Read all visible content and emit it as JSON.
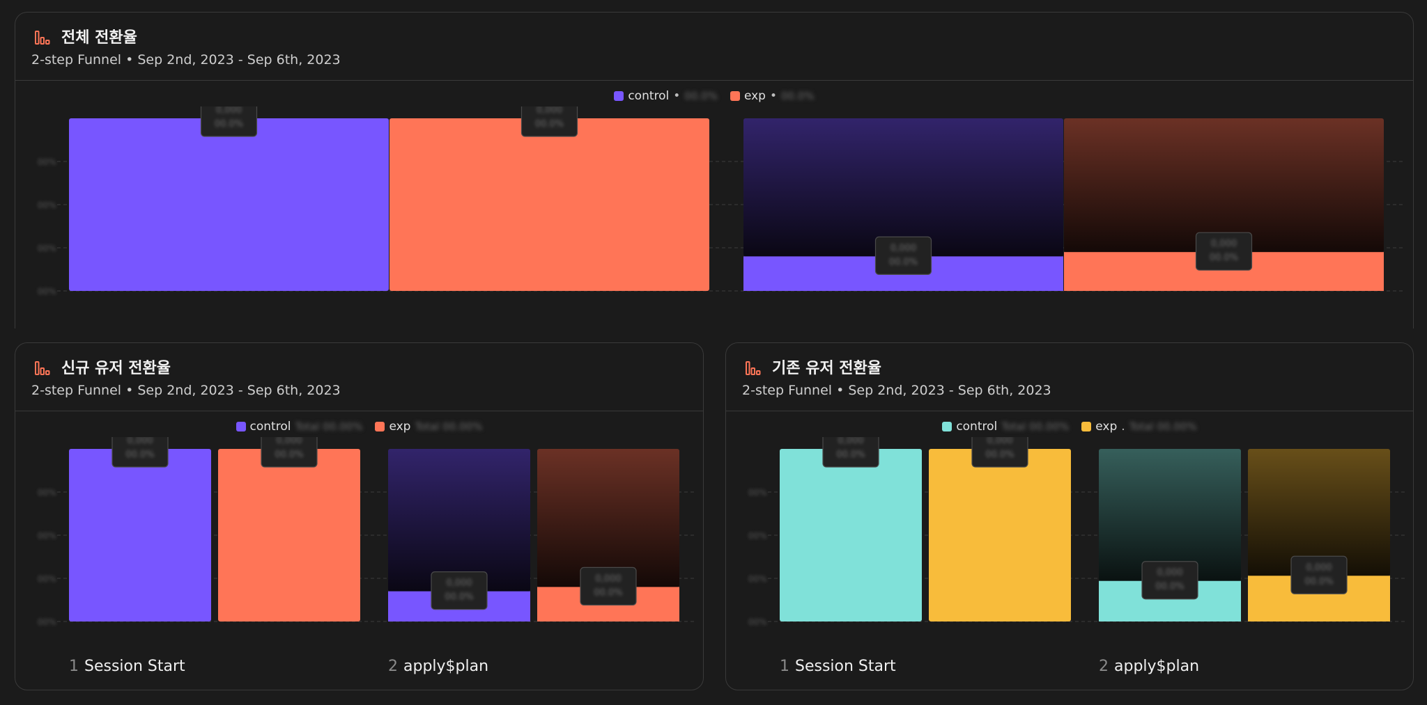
{
  "cards": [
    {
      "title": "전체 전환율",
      "subtitle": "2-step Funnel • Sep 2nd, 2023 - Sep 6th, 2023",
      "legend": [
        {
          "name": "control",
          "sep": "•",
          "color": "#7856ff"
        },
        {
          "name": "exp",
          "sep": "•",
          "color": "#ff7557"
        }
      ]
    },
    {
      "title": "신규 유저 전환율",
      "subtitle": "2-step Funnel • Sep 2nd, 2023 - Sep 6th, 2023",
      "legend": [
        {
          "name": "control",
          "sep": "",
          "color": "#7856ff"
        },
        {
          "name": "exp",
          "sep": "",
          "color": "#ff7557"
        }
      ],
      "steps": [
        {
          "num": "1",
          "label": "Session Start"
        },
        {
          "num": "2",
          "label": "apply$plan"
        }
      ]
    },
    {
      "title": "기존 유저 전환율",
      "subtitle": "2-step Funnel • Sep 2nd, 2023 - Sep 6th, 2023",
      "legend": [
        {
          "name": "control",
          "sep": "",
          "color": "#80e1d9"
        },
        {
          "name": "exp",
          "sep": ".",
          "color": "#f8bc3b"
        }
      ],
      "steps": [
        {
          "num": "1",
          "label": "Session Start"
        },
        {
          "num": "2",
          "label": "apply$plan"
        }
      ]
    }
  ],
  "chart_data": [
    {
      "type": "bar",
      "categories": [
        "Session Start",
        "apply$plan"
      ],
      "series": [
        {
          "name": "control",
          "values": [
            100,
            20
          ],
          "color": "#7856ff"
        },
        {
          "name": "exp",
          "values": [
            100,
            22.5
          ],
          "color": "#ff7557"
        }
      ],
      "ylim": [
        0,
        100
      ],
      "grid": true
    },
    {
      "type": "bar",
      "categories": [
        "Session Start",
        "apply$plan"
      ],
      "series": [
        {
          "name": "control",
          "values": [
            100,
            17.5
          ],
          "color": "#7856ff"
        },
        {
          "name": "exp",
          "values": [
            100,
            20
          ],
          "color": "#ff7557"
        }
      ],
      "ylim": [
        0,
        100
      ],
      "grid": true
    },
    {
      "type": "bar",
      "categories": [
        "Session Start",
        "apply$plan"
      ],
      "series": [
        {
          "name": "control",
          "values": [
            100,
            23.5
          ],
          "color": "#80e1d9"
        },
        {
          "name": "exp",
          "values": [
            100,
            26.5
          ],
          "color": "#f8bc3b"
        }
      ],
      "ylim": [
        0,
        100
      ],
      "grid": true
    }
  ]
}
